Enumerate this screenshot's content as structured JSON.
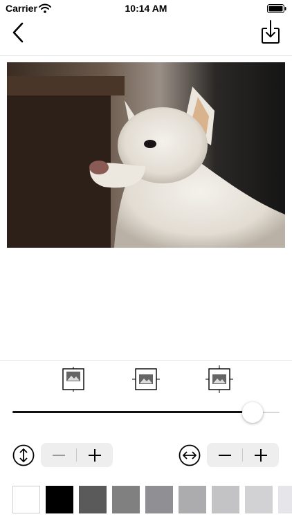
{
  "status_bar": {
    "carrier": "Carrier",
    "time": "10:14 AM"
  },
  "nav": {
    "back_icon": "chevron-left-icon",
    "save_icon": "save-to-device-icon"
  },
  "photo": {
    "subject": "white dog",
    "icon": "photo-image"
  },
  "position_options": [
    "align-top",
    "align-center",
    "align-bottom"
  ],
  "slider": {
    "value": 0.9
  },
  "vertical_adjust": {
    "icon": "vertical-arrows-icon",
    "minus": "−",
    "plus": "+"
  },
  "horizontal_adjust": {
    "icon": "horizontal-arrows-icon",
    "minus": "−",
    "plus": "+"
  },
  "swatches": [
    "#ffffff",
    "#000000",
    "#5a5a5a",
    "#808080",
    "#8f8f94",
    "#acacaf",
    "#c3c3c6",
    "#d2d2d5",
    "#e6e6ea"
  ],
  "colors": {
    "accent": "#111111",
    "stepper_bg": "#eeeeef",
    "divider": "#e2e2e2"
  }
}
